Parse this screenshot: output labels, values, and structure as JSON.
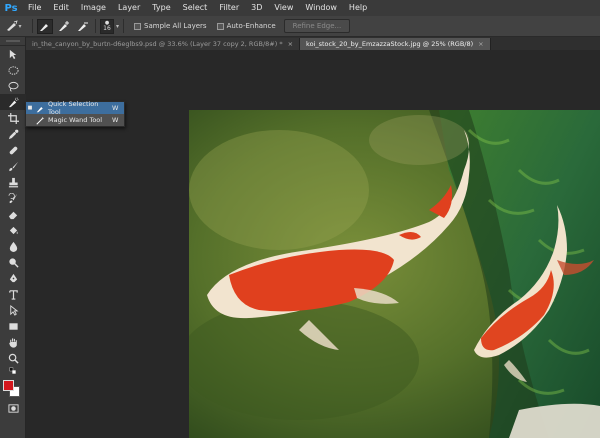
{
  "app": {
    "logo": "Ps"
  },
  "menu": [
    "File",
    "Edit",
    "Image",
    "Layer",
    "Type",
    "Select",
    "Filter",
    "3D",
    "View",
    "Window",
    "Help"
  ],
  "options": {
    "brush_size": "16",
    "sample_all_layers": "Sample All Layers",
    "auto_enhance": "Auto-Enhance",
    "refine_edge": "Refine Edge..."
  },
  "tabs": [
    {
      "label": "in_the_canyon_by_burtn-d6eglbs9.psd @ 33.6% (Layer 37 copy 2, RGB/8#) *",
      "close": "×"
    },
    {
      "label": "koi_stock_20_by_EmzazzaStock.jpg @ 25% (RGB/8)",
      "close": "×"
    }
  ],
  "flyout": {
    "items": [
      {
        "label": "Quick Selection Tool",
        "key": "W"
      },
      {
        "label": "Magic Wand Tool",
        "key": "W"
      }
    ]
  },
  "colors": {
    "foreground": "#d4171d",
    "background": "#ffffff",
    "accent": "#31a8ff"
  }
}
